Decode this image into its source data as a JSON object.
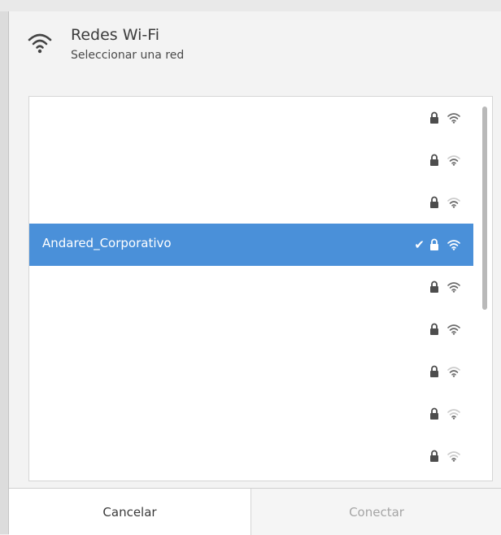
{
  "dialog": {
    "title": "Redes Wi-Fi",
    "subtitle": "Seleccionar una red",
    "icon": "wifi-icon"
  },
  "networks": [
    {
      "label": "",
      "secured": true,
      "signal": "strong",
      "selected": false
    },
    {
      "label": "",
      "secured": true,
      "signal": "medium",
      "selected": false
    },
    {
      "label": "",
      "secured": true,
      "signal": "medium",
      "selected": false
    },
    {
      "label": "Andared_Corporativo",
      "secured": true,
      "signal": "strong",
      "selected": true,
      "connected": true
    },
    {
      "label": "",
      "secured": true,
      "signal": "strong",
      "selected": false
    },
    {
      "label": "",
      "secured": true,
      "signal": "strong",
      "selected": false
    },
    {
      "label": "",
      "secured": true,
      "signal": "medium",
      "selected": false
    },
    {
      "label": "",
      "secured": true,
      "signal": "weak",
      "selected": false
    },
    {
      "label": "",
      "secured": true,
      "signal": "weak",
      "selected": false
    }
  ],
  "buttons": {
    "cancel": "Cancelar",
    "connect": "Conectar"
  },
  "colors": {
    "selection": "#4a90d9",
    "disabled_text": "#a5a5a5"
  }
}
